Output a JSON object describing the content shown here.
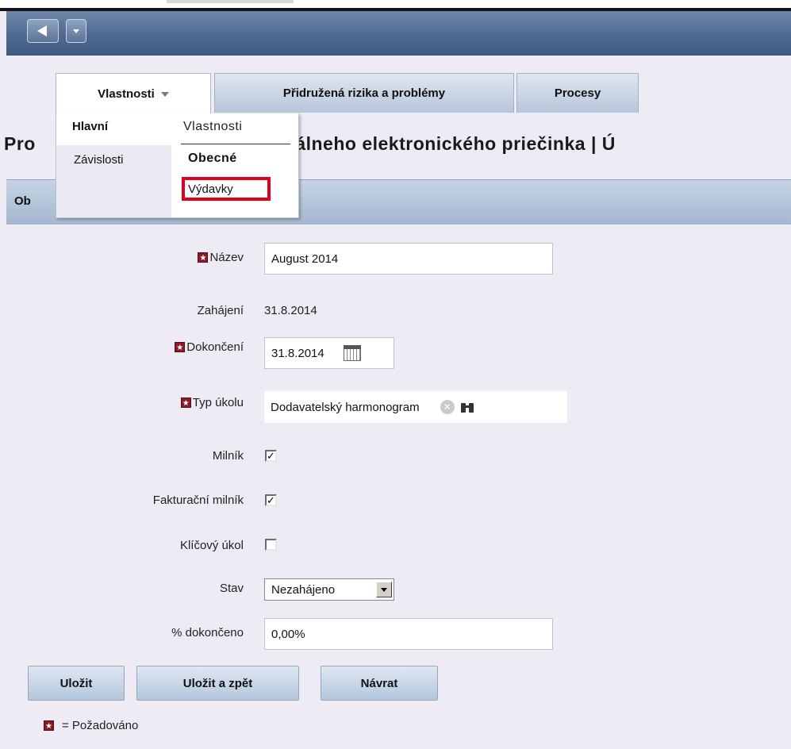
{
  "tabs": {
    "properties": "Vlastnosti",
    "risks": "Přidružená rizika a problémy",
    "processes": "Procesy"
  },
  "menu": {
    "main": "Hlavní",
    "dependencies": "Závislosti",
    "properties_header": "Vlastnosti",
    "general": "Obecné",
    "expenses": "Výdavky"
  },
  "page": {
    "title_left": "Pro",
    "title_right": "žby centrálneho elektronického priečinka | Ú",
    "section_label": "Ob"
  },
  "form": {
    "required_glyph": "★",
    "name_label": "Název",
    "name_value": "August 2014",
    "start_label": "Zahájení",
    "start_value": "31.8.2014",
    "finish_label": "Dokončení",
    "finish_value": "31.8.2014",
    "task_type_label": "Typ úkolu",
    "task_type_value": "Dodavatelský harmonogram",
    "milestone_label": "Milník",
    "milestone_checked": true,
    "billing_milestone_label": "Fakturační milník",
    "billing_milestone_checked": true,
    "key_task_label": "Klíčový úkol",
    "key_task_checked": false,
    "status_label": "Stav",
    "status_value": "Nezahájeno",
    "percent_label": "% dokončeno",
    "percent_value": "0,00%"
  },
  "buttons": {
    "save": "Uložit",
    "save_back": "Uložit a zpět",
    "return": "Návrat"
  },
  "legend": {
    "text": "= Požadováno"
  },
  "icons": {
    "back": "back-arrow-icon",
    "dropdown": "chevron-down-icon",
    "calendar": "calendar-icon",
    "clear": "clear-icon",
    "lookup": "binoculars-icon",
    "required": "required-star-icon"
  },
  "colors": {
    "required": "#8b1a24",
    "highlight": "#e0001b",
    "nav": "#4f6a91"
  }
}
